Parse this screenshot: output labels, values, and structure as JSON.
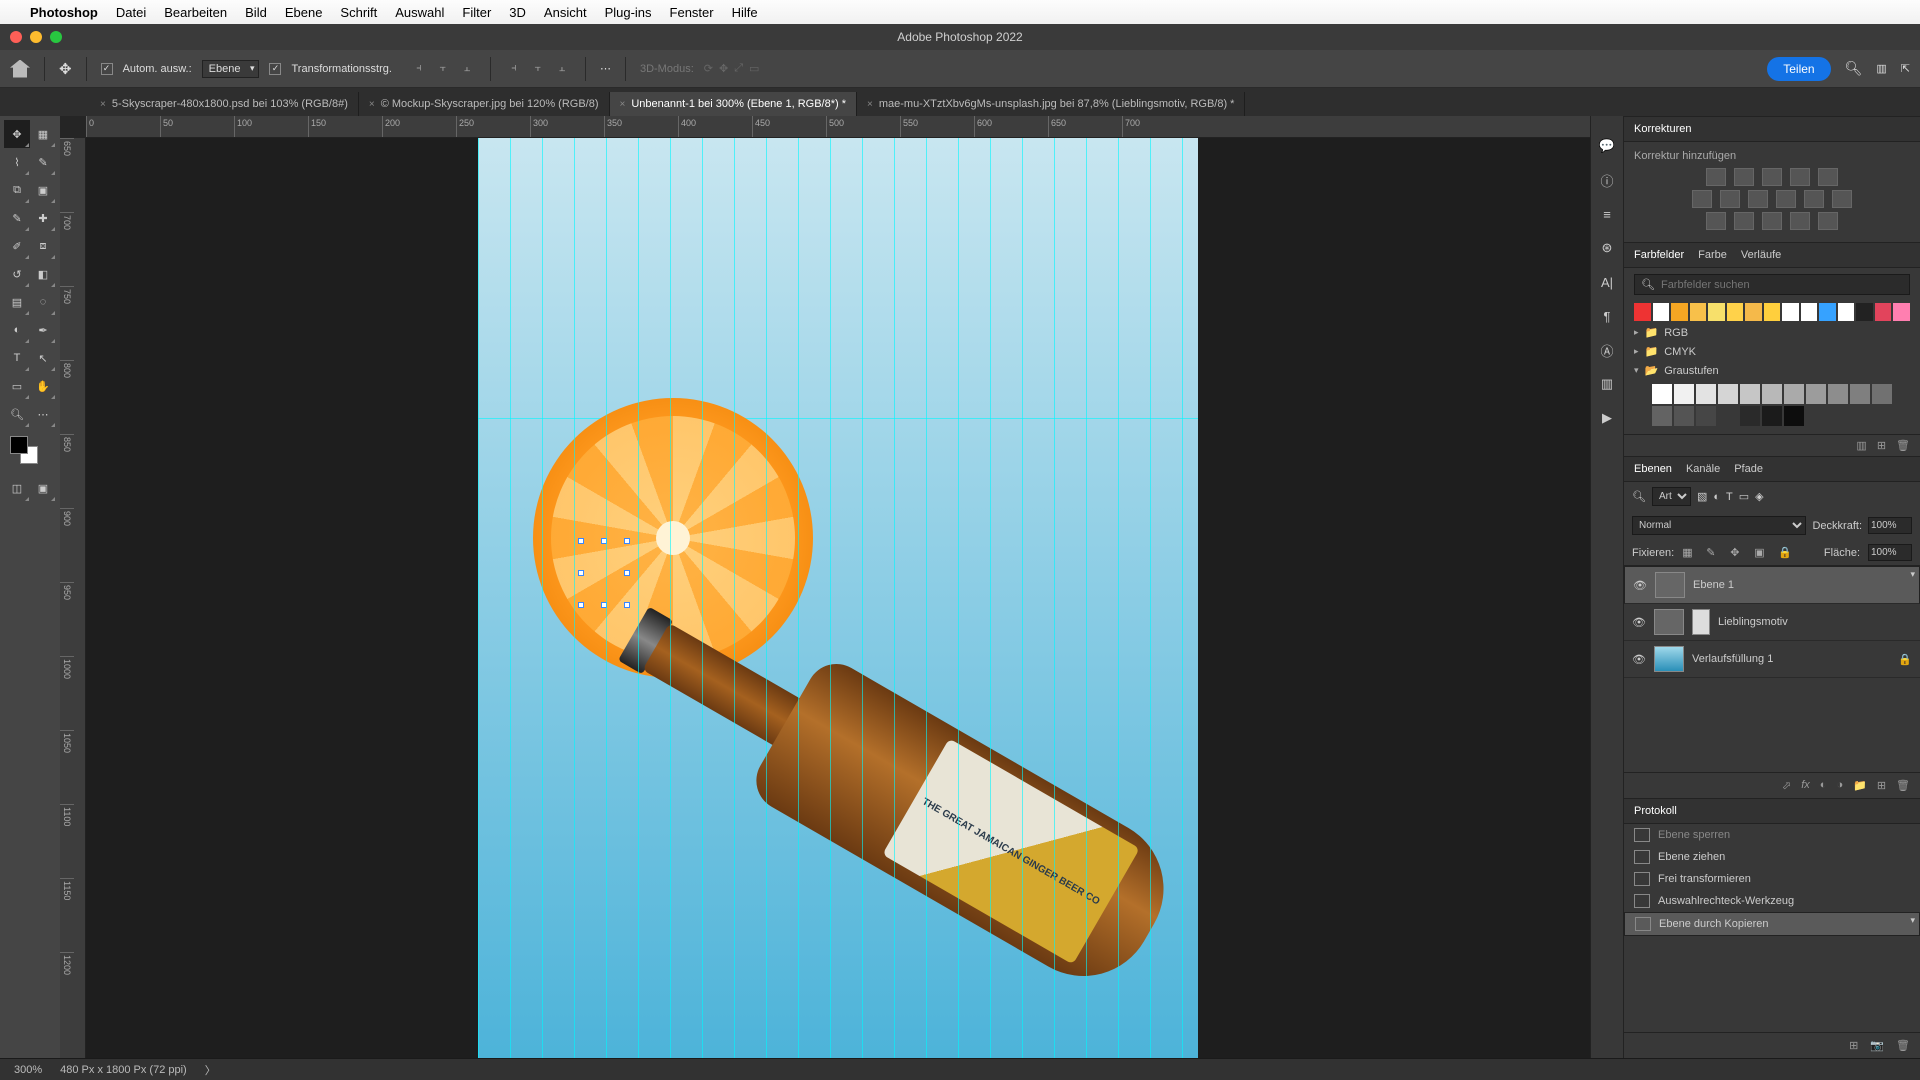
{
  "menu": {
    "app": "Photoshop",
    "items": [
      "Datei",
      "Bearbeiten",
      "Bild",
      "Ebene",
      "Schrift",
      "Auswahl",
      "Filter",
      "3D",
      "Ansicht",
      "Plug-ins",
      "Fenster",
      "Hilfe"
    ]
  },
  "window": {
    "title": "Adobe Photoshop 2022"
  },
  "optbar": {
    "auto_select": "Autom. ausw.:",
    "auto_target": "Ebene",
    "transform": "Transformationsstrg.",
    "mode3d": "3D-Modus:",
    "share": "Teilen"
  },
  "tabs": [
    {
      "label": "5-Skyscraper-480x1800.psd bei 103% (RGB/8#)",
      "active": false
    },
    {
      "label": "© Mockup-Skyscraper.jpg bei 120% (RGB/8)",
      "active": false
    },
    {
      "label": "Unbenannt-1 bei 300% (Ebene 1, RGB/8*) *",
      "active": true
    },
    {
      "label": "mae-mu-XTztXbv6gMs-unsplash.jpg bei 87,8% (Lieblingsmotiv, RGB/8) *",
      "active": false
    }
  ],
  "ruler_h": [
    "0",
    "50",
    "100",
    "150",
    "200",
    "250",
    "300",
    "350",
    "400",
    "450",
    "500",
    "550",
    "600",
    "650",
    "700"
  ],
  "ruler_v": [
    "650",
    "700",
    "750",
    "800",
    "850",
    "900",
    "950",
    "1000",
    "1050",
    "1100",
    "1150",
    "1200"
  ],
  "label_text": "THE GREAT JAMAICAN\nGINGER BEER CO",
  "panels": {
    "adjustments": {
      "title": "Korrekturen",
      "hint": "Korrektur hinzufügen"
    },
    "swatches": {
      "tabs": [
        "Farbfelder",
        "Farbe",
        "Verläufe"
      ],
      "search_ph": "Farbfelder suchen",
      "row1": [
        "#e33",
        "#fff",
        "#f5a623",
        "#f8c04a",
        "#f7e06b",
        "#ffd24a",
        "#f5b94a",
        "#ffcf3d",
        "#fff",
        "#fff",
        "#36a2ff",
        "#fff",
        "#222",
        "#e2445c",
        "#ff7fb0"
      ],
      "folders": [
        "RGB",
        "CMYK",
        "Graustufen"
      ],
      "grays": [
        "#ffffff",
        "#f1f1f1",
        "#e3e3e3",
        "#d5d5d5",
        "#c6c6c6",
        "#b8b8b8",
        "#aaaaaa",
        "#9c9c9c",
        "#8d8d8d",
        "#7f7f7f",
        "#717171",
        "#636363",
        "#545454",
        "#464646",
        "#383838",
        "#2a2a2a",
        "#1b1b1b",
        "#0d0d0d"
      ]
    },
    "layers": {
      "tabs": [
        "Ebenen",
        "Kanäle",
        "Pfade"
      ],
      "kind": "Art",
      "blend": "Normal",
      "opacity_lbl": "Deckkraft:",
      "opacity": "100%",
      "lock_lbl": "Fixieren:",
      "fill_lbl": "Fläche:",
      "fill": "100%",
      "items": [
        {
          "name": "Ebene 1",
          "sel": true,
          "locked": false
        },
        {
          "name": "Lieblingsmotiv",
          "sel": false,
          "locked": false
        },
        {
          "name": "Verlaufsfüllung 1",
          "sel": false,
          "locked": true
        }
      ]
    },
    "history": {
      "title": "Protokoll",
      "items": [
        "Ebene sperren",
        "Ebene ziehen",
        "Frei transformieren",
        "Auswahlrechteck-Werkzeug",
        "Ebene durch Kopieren"
      ]
    }
  },
  "status": {
    "zoom": "300%",
    "dims": "480 Px x 1800 Px (72 ppi)"
  }
}
